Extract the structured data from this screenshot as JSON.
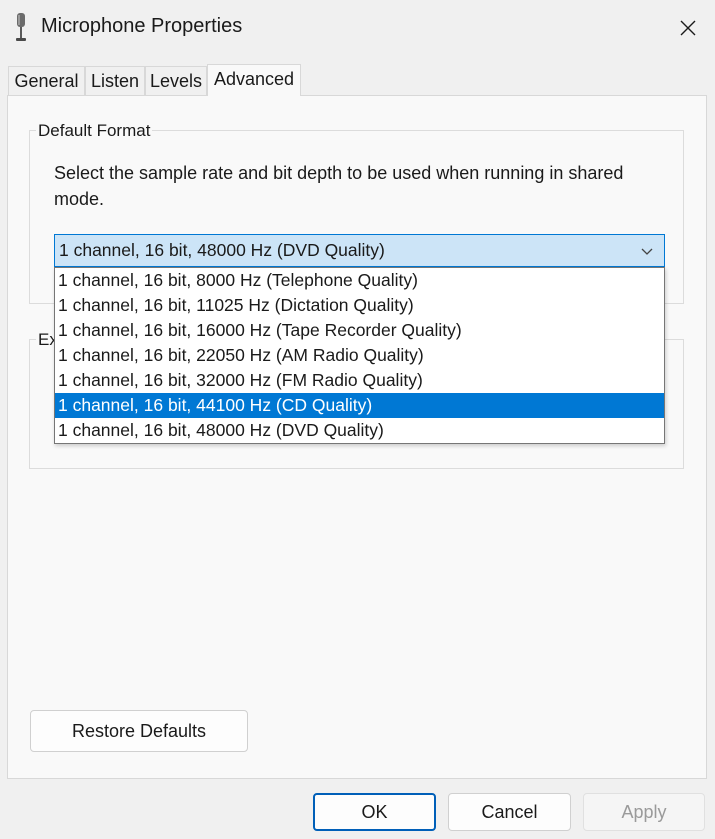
{
  "window": {
    "title": "Microphone Properties",
    "icon": "microphone-icon",
    "close_icon": "close-icon"
  },
  "tabs": [
    {
      "label": "General",
      "active": false
    },
    {
      "label": "Listen",
      "active": false
    },
    {
      "label": "Levels",
      "active": false
    },
    {
      "label": "Advanced",
      "active": true
    }
  ],
  "default_format": {
    "group_label": "Default Format",
    "description": "Select the sample rate and bit depth to be used when running in shared mode.",
    "selected_value": "1 channel, 16 bit, 48000 Hz (DVD Quality)",
    "options": [
      "1 channel, 16 bit, 8000 Hz (Telephone Quality)",
      "1 channel, 16 bit, 11025 Hz (Dictation Quality)",
      "1 channel, 16 bit, 16000 Hz (Tape Recorder Quality)",
      "1 channel, 16 bit, 22050 Hz (AM Radio Quality)",
      "1 channel, 16 bit, 32000 Hz (FM Radio Quality)",
      "1 channel, 16 bit, 44100 Hz (CD Quality)",
      "1 channel, 16 bit, 48000 Hz (DVD Quality)"
    ],
    "highlighted_option": "1 channel, 16 bit, 44100 Hz (CD Quality)"
  },
  "exclusive_mode": {
    "group_label_partial": "Ex"
  },
  "buttons": {
    "restore_defaults": "Restore Defaults",
    "ok": "OK",
    "cancel": "Cancel",
    "apply": "Apply"
  },
  "colors": {
    "accent": "#0078d4",
    "combo_highlight": "#cce4f7",
    "disabled_text": "#9a9a9a"
  }
}
